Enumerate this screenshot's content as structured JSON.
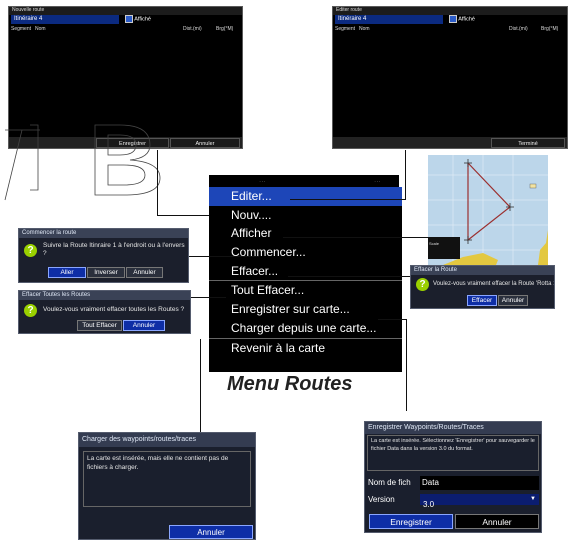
{
  "new_route": {
    "title": "Nouvelle route",
    "name": "Itinéraire 4",
    "shown_label": "Affiché",
    "col_segment": "Segment",
    "col_name": "Nom",
    "col_dist": "Dist.(mi)",
    "col_brg": "Brg(°M)",
    "save_button": "Enregistrer",
    "cancel_button": "Annuler"
  },
  "edit_route": {
    "title": "Editer route",
    "name": "Itinéraire 4",
    "shown_label": "Affiché",
    "col_segment": "Segment",
    "col_name": "Nom",
    "col_dist": "Dist.(mi)",
    "col_brg": "Brg(°M)",
    "done_button": "Terminé"
  },
  "menu": {
    "partial_top_left": "...",
    "partial_top_right": "...",
    "items": [
      {
        "label": "Editer..."
      },
      {
        "label": "Nouv...."
      },
      {
        "label": "Afficher"
      },
      {
        "label": "Commencer..."
      },
      {
        "label": "Effacer..."
      },
      {
        "label": "Tout Effacer..."
      },
      {
        "label": "Enregistrer sur carte..."
      },
      {
        "label": "Charger depuis une carte..."
      },
      {
        "label": "Revenir à la carte"
      }
    ],
    "caption": "Menu Routes"
  },
  "start_route": {
    "title": "Commencer la route",
    "message": "Suivre la Route Itinraire 1 à l'endroit ou à l'envers ?",
    "btn_go": "Aller",
    "btn_reverse": "Inverser",
    "btn_cancel": "Annuler"
  },
  "clear_all": {
    "title": "Effacer Toutes les Routes",
    "message": "Voulez-vous vraiment effacer toutes les Routes ?",
    "btn_clear_all": "Tout Effacer",
    "btn_cancel": "Annuler"
  },
  "delete_route": {
    "title": "Effacer la Route",
    "message": "Voulez-vous vraiment effacer la Route 'Rotta 1' ?",
    "btn_delete": "Effacer",
    "btn_cancel": "Annuler"
  },
  "load": {
    "title": "Charger des waypoints/routes/traces",
    "message": "La carte est insérée, mais elle ne contient pas de fichiers à charger.",
    "btn_cancel": "Annuler"
  },
  "save_card": {
    "title": "Enregistrer Waypoints/Routes/Traces",
    "message": "La carte est insérée. Sélectionnez 'Enregistrer' pour sauvegarder le fichier Data dans la version 3.0 du format.",
    "filename_label": "Nom de fich",
    "filename_value": "Data",
    "version_label": "Version",
    "version_value": "3.0",
    "btn_save": "Enregistrer",
    "btn_cancel": "Annuler"
  },
  "map_preview": {
    "scale_text": "Scale"
  }
}
